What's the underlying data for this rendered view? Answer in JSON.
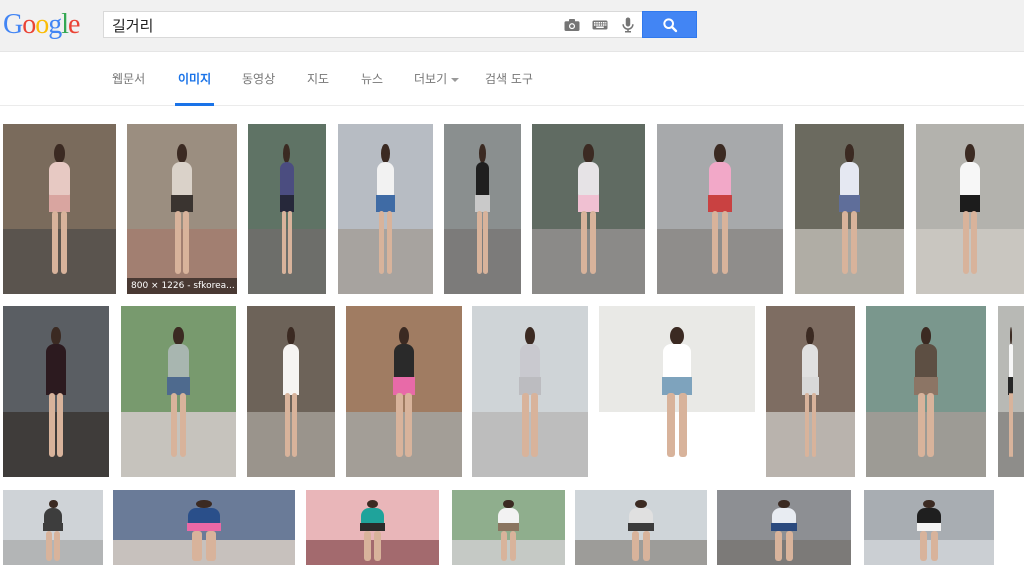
{
  "logo": {
    "letters": [
      {
        "ch": "G",
        "color": "#4285f4"
      },
      {
        "ch": "o",
        "color": "#ea4335"
      },
      {
        "ch": "o",
        "color": "#fbbc05"
      },
      {
        "ch": "g",
        "color": "#4285f4"
      },
      {
        "ch": "l",
        "color": "#34a853"
      },
      {
        "ch": "e",
        "color": "#ea4335"
      }
    ]
  },
  "search": {
    "value": "길거리",
    "tools": [
      "camera-icon",
      "keyboard-icon",
      "microphone-icon"
    ],
    "button_icon": "search-icon",
    "button_color": "#4285f4"
  },
  "tabs": [
    {
      "label": "웹문서",
      "active": false
    },
    {
      "label": "이미지",
      "active": true
    },
    {
      "label": "동영상",
      "active": false
    },
    {
      "label": "지도",
      "active": false
    },
    {
      "label": "뉴스",
      "active": false
    },
    {
      "label": "더보기",
      "active": false,
      "dropdown": true
    },
    {
      "label": "검색 도구",
      "active": false
    }
  ],
  "results": {
    "rows": [
      [
        {
          "bg": "#7a6b5c",
          "ground": "#5a544e",
          "top": "#e7c9c3",
          "skirt": "#d9a5a0"
        },
        {
          "bg": "#9b8e80",
          "ground": "#a27f71",
          "top": "#dad2c9",
          "skirt": "#3a3430",
          "caption": "800 × 1226 - sfkorea..."
        },
        {
          "bg": "#5f7365",
          "ground": "#6d6e6a",
          "top": "#4b4d80",
          "skirt": "#26283a"
        },
        {
          "bg": "#b7bcc3",
          "ground": "#a7a39f",
          "top": "#f2f2f2",
          "skirt": "#3f6ba5"
        },
        {
          "bg": "#8a8f8f",
          "ground": "#7c7b7a",
          "top": "#1f1f1f",
          "skirt": "#c9c9c9"
        },
        {
          "bg": "#606b62",
          "ground": "#8b8a88",
          "top": "#e6e3e6",
          "skirt": "#f0c0d2"
        },
        {
          "bg": "#a7a9ab",
          "ground": "#8f8d8b",
          "top": "#f2a8c8",
          "skirt": "#c94141"
        },
        {
          "bg": "#6b6a5f",
          "ground": "#b0ada5",
          "top": "#e5e8f2",
          "skirt": "#5f6e9a"
        },
        {
          "bg": "#b3b2ad",
          "ground": "#c9c6c0",
          "top": "#f7f7f7",
          "skirt": "#1c1c1c"
        }
      ],
      [
        {
          "bg": "#5a5e63",
          "ground": "#3f3c3a",
          "top": "#2c1a1f",
          "skirt": "#2c1a1f"
        },
        {
          "bg": "#789a6e",
          "ground": "#c6c3bd",
          "top": "#a8b6b0",
          "skirt": "#4e6a8e"
        },
        {
          "bg": "#6d6359",
          "ground": "#9a948c",
          "top": "#f6f4f2",
          "skirt": "#f6f4f2"
        },
        {
          "bg": "#a07c62",
          "ground": "#a39e97",
          "top": "#2a2a2a",
          "skirt": "#e86aa8"
        },
        {
          "bg": "#cfd4d7",
          "ground": "#bdbdbd",
          "top": "#c9c9cf",
          "skirt": "#bcbcc0"
        },
        {
          "bg": "#e9e9e6",
          "ground": "#ffffff",
          "top": "#ffffff",
          "skirt": "#7ea3bd"
        },
        {
          "bg": "#7e6d62",
          "ground": "#b9b3ad",
          "top": "#e0e0e0",
          "skirt": "#d8d8d8"
        },
        {
          "bg": "#7a978d",
          "ground": "#9d9b95",
          "top": "#5d4f43",
          "skirt": "#8c7565"
        },
        {
          "bg": "#b8b9b5",
          "ground": "#8e8d8a",
          "top": "#f7f7f7",
          "skirt": "#262626"
        }
      ],
      [
        {
          "bg": "#cfd3d7",
          "ground": "#b3b5b6",
          "top": "#3d3d3d",
          "skirt": "#3d3d3d"
        },
        {
          "bg": "#6a7b98",
          "ground": "#c7c1bd",
          "top": "#2a4f8a",
          "skirt": "#ea68a6"
        },
        {
          "bg": "#e9b6b9",
          "ground": "#a36a6e",
          "top": "#1fa39b",
          "skirt": "#2b2b2b"
        },
        {
          "bg": "#8fae8d",
          "ground": "#c5c9c5",
          "top": "#f2f2f2",
          "skirt": "#8a7560"
        },
        {
          "bg": "#cfd5d9",
          "ground": "#9d9c99",
          "top": "#e0e0e0",
          "skirt": "#3b3b3b"
        },
        {
          "bg": "#8d8f93",
          "ground": "#7c7a78",
          "top": "#e8ecf2",
          "skirt": "#2b4a7e"
        },
        {
          "bg": "#a8adb2",
          "ground": "#cbcfd3",
          "top": "#1f1f1f",
          "skirt": "#f4f4f4"
        }
      ]
    ]
  }
}
